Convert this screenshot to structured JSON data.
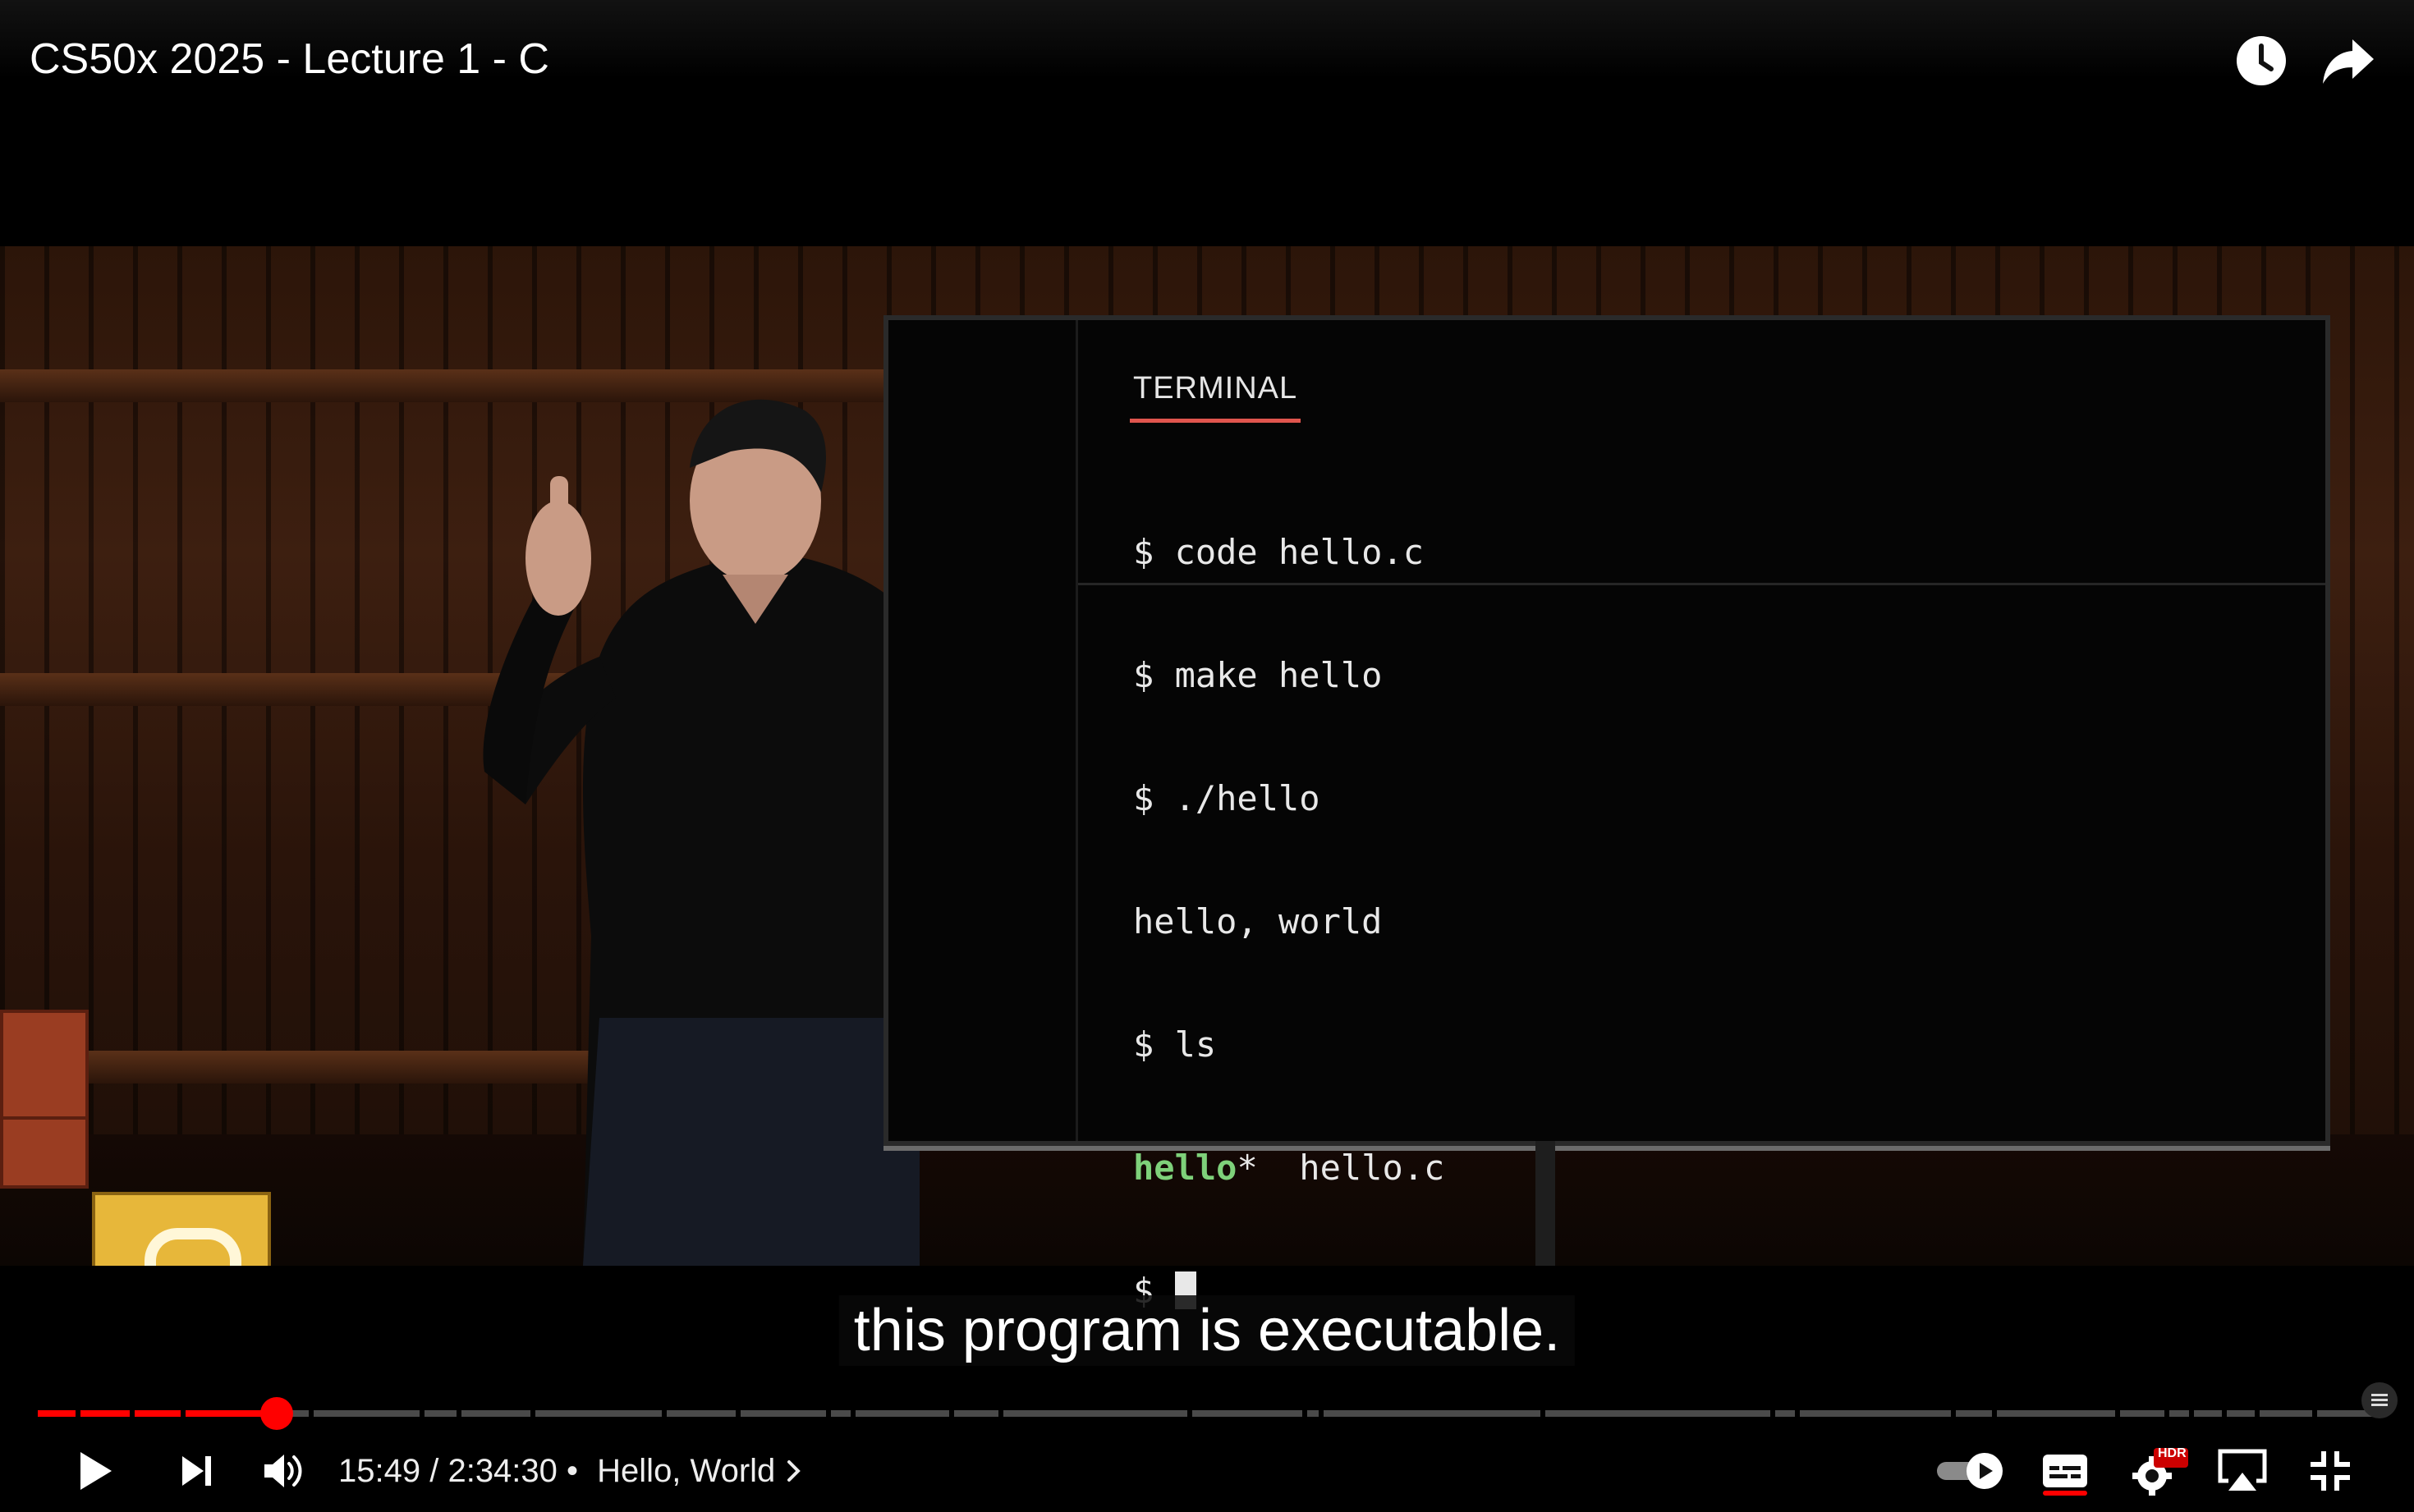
{
  "video": {
    "title": "CS50x 2025 - Lecture 1 - C"
  },
  "top_actions": [
    {
      "name": "watch-later-icon"
    },
    {
      "name": "share-icon"
    }
  ],
  "terminal": {
    "tab_label": "TERMINAL",
    "lines": [
      {
        "text": "$ code hello.c"
      },
      {
        "text": "$ make hello"
      },
      {
        "text": "$ ./hello"
      },
      {
        "text": "hello, world"
      },
      {
        "text": "$ ls"
      },
      {
        "exec_name": "hello",
        "exec_suffix": "*",
        "rest": "  hello.c"
      },
      {
        "prompt": "$ "
      }
    ],
    "colors": {
      "executable": "#7ed17a",
      "underline": "#e0554e"
    }
  },
  "caption": {
    "text": "this program is executable."
  },
  "playback": {
    "current_time": "15:49",
    "separator": " / ",
    "duration": "2:34:30",
    "bullet": " • ",
    "chapter": "Hello, World",
    "progress_fraction": 0.1024,
    "progress_color": "#ff0000"
  },
  "controls": {
    "play_icon": "play-icon",
    "next_icon": "next-icon",
    "volume_icon": "volume-icon",
    "autoplay_toggle": "autoplay-toggle",
    "subtitles_icon": "subtitles-icon",
    "settings_icon": "settings-gear-icon",
    "settings_badge": "HDR",
    "airplay_icon": "airplay-icon",
    "exit_fullscreen_icon": "exit-fullscreen-icon"
  }
}
